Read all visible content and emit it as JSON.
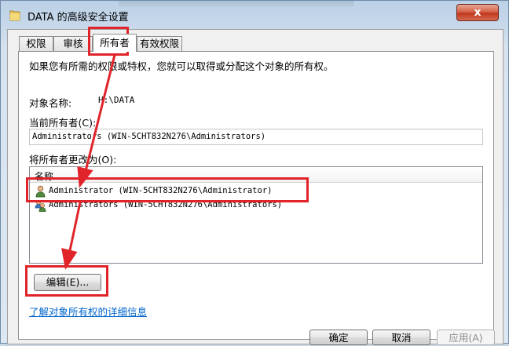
{
  "window": {
    "title": "DATA 的高级安全设置",
    "close_label": "x"
  },
  "tabs": [
    {
      "label": "权限"
    },
    {
      "label": "审核"
    },
    {
      "label": "所有者",
      "active": true
    },
    {
      "label": "有效权限"
    }
  ],
  "owner_tab": {
    "intro": "如果您有所需的权限或特权，您就可以取得或分配这个对象的所有权。",
    "object_name_label": "对象名称:",
    "object_name_value": "H:\\DATA",
    "current_owner_label": "当前所有者(C):",
    "current_owner_value": "Administrators (WIN-5CHT832N276\\Administrators)",
    "change_owner_label": "将所有者更改为(O):",
    "list_header": "名称",
    "list_items": [
      {
        "label": "Administrator (WIN-5CHT832N276\\Administrator)",
        "icon": "user-icon"
      },
      {
        "label": "Administrators (WIN-5CHT832N276\\Administrators)",
        "icon": "group-users-icon"
      }
    ],
    "edit_button": "编辑(E)...",
    "learn_link": "了解对象所有权的详细信息"
  },
  "footer": {
    "ok": "确定",
    "cancel": "取消",
    "apply": "应用(A)"
  },
  "colors": {
    "annotation_red": "#e0242a",
    "link_blue": "#0066cc"
  }
}
